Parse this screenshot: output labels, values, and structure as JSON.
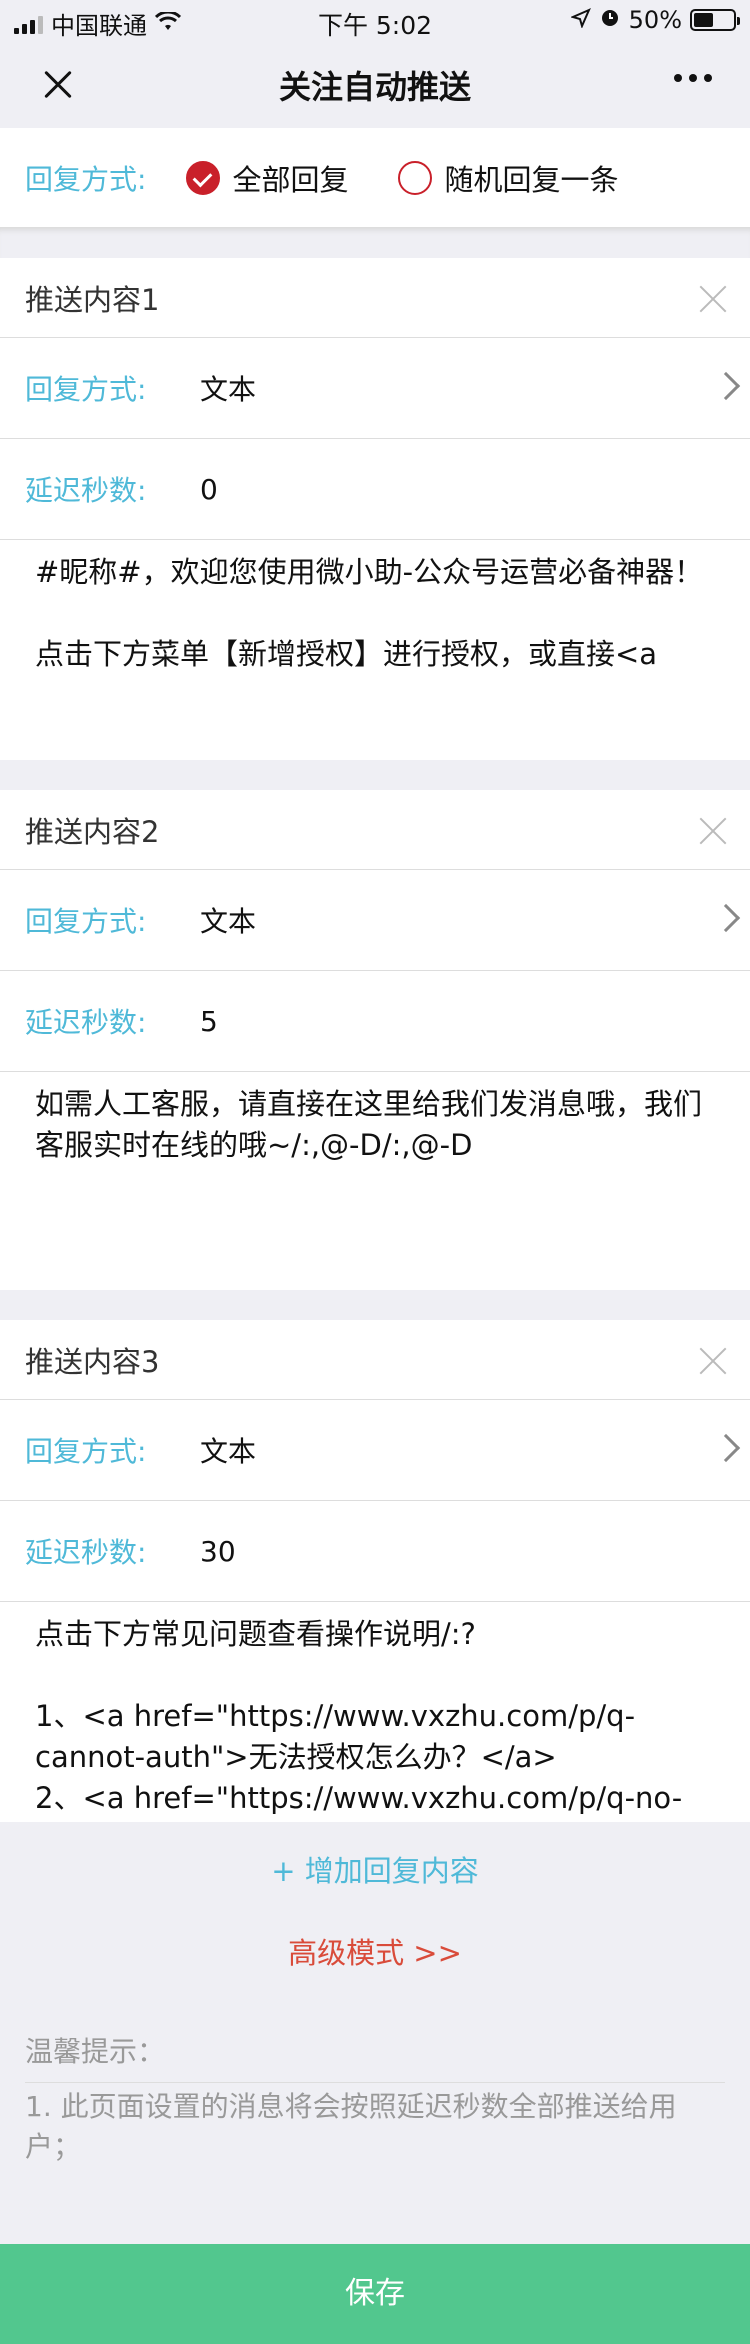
{
  "status_bar": {
    "carrier": "中国联通",
    "time": "下午 5:02",
    "battery": "50%"
  },
  "nav": {
    "title": "关注自动推送"
  },
  "reply_mode": {
    "label": "回复方式:",
    "options": [
      "全部回复",
      "随机回复一条"
    ],
    "selected": "全部回复"
  },
  "sections": [
    {
      "title": "推送内容1",
      "mode_label": "回复方式:",
      "mode_value": "文本",
      "delay_label": "延迟秒数:",
      "delay_value": "0",
      "content": "#昵称#，欢迎您使用微小助-公众号运营必备神器！\n\n点击下方菜单【新增授权】进行授权，或直接<a"
    },
    {
      "title": "推送内容2",
      "mode_label": "回复方式:",
      "mode_value": "文本",
      "delay_label": "延迟秒数:",
      "delay_value": "5",
      "content": "如需人工客服，请直接在这里给我们发消息哦，我们客服实时在线的哦~/:,@-D/:,@-D"
    },
    {
      "title": "推送内容3",
      "mode_label": "回复方式:",
      "mode_value": "文本",
      "delay_label": "延迟秒数:",
      "delay_value": "30",
      "content": "点击下方常见问题查看操作说明/:?\n\n1、<a href=\"https://www.vxzhu.com/p/q-cannot-auth\">无法授权怎么办？</a>\n2、<a href=\"https://www.vxzhu.com/p/q-no-"
    }
  ],
  "actions": {
    "add_label": "+ 增加回复内容",
    "advanced_label": "高级模式 >>",
    "save_label": "保存"
  },
  "tips": {
    "title": "温馨提示：",
    "text": "1. 此页面设置的消息将会按照延迟秒数全部推送给用户；"
  },
  "colors": {
    "accent_blue": "#4fb9d8",
    "check_red": "#c9202a",
    "advanced_red": "#d94b3a",
    "save_green": "#52c78e"
  }
}
